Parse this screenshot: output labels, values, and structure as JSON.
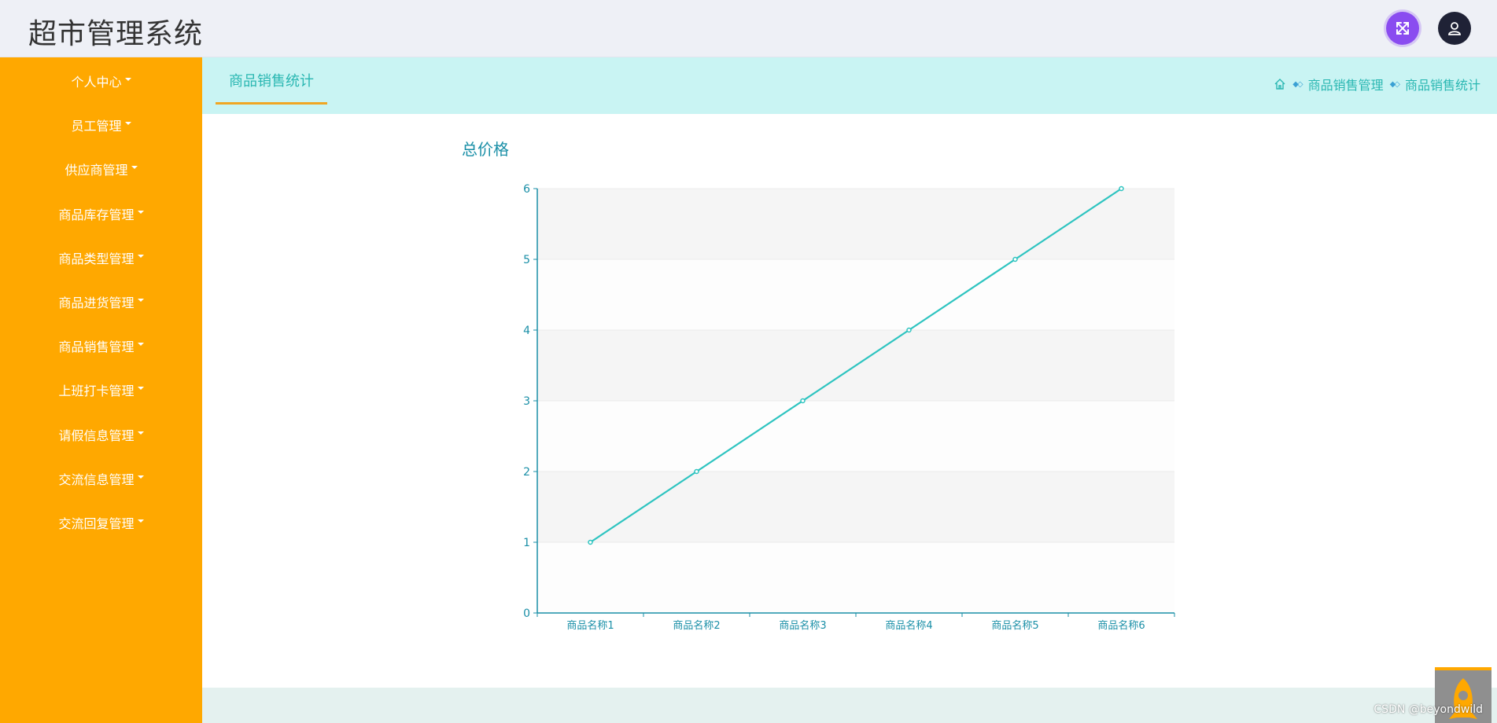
{
  "app": {
    "title": "超市管理系统"
  },
  "header": {
    "fullscreen_icon": "fullscreen-icon",
    "user_icon": "user-icon",
    "accent": "#8a4cf0"
  },
  "sidebar": {
    "background": "#ffa800",
    "items": [
      {
        "label": "个人中心"
      },
      {
        "label": "员工管理"
      },
      {
        "label": "供应商管理"
      },
      {
        "label": "商品库存管理"
      },
      {
        "label": "商品类型管理"
      },
      {
        "label": "商品进货管理"
      },
      {
        "label": "商品销售管理"
      },
      {
        "label": "上班打卡管理"
      },
      {
        "label": "请假信息管理"
      },
      {
        "label": "交流信息管理"
      },
      {
        "label": "交流回复管理"
      }
    ]
  },
  "tabs": [
    {
      "label": "商品销售统计",
      "active": true
    }
  ],
  "breadcrumb": {
    "home_icon": "home-icon",
    "items": [
      "商品销售管理",
      "商品销售统计"
    ]
  },
  "chart_data": {
    "type": "line",
    "title": "总价格",
    "categories": [
      "商品名称1",
      "商品名称2",
      "商品名称3",
      "商品名称4",
      "商品名称5",
      "商品名称6"
    ],
    "series": [
      {
        "values": [
          1,
          2,
          3,
          4,
          5,
          6
        ],
        "color": "#2ec4c0"
      }
    ],
    "yticks": [
      0,
      1,
      2,
      3,
      4,
      5,
      6
    ],
    "ylim": [
      0,
      6
    ],
    "grid": "alternating horizontal bands",
    "axis_color": "#1a8fa7"
  },
  "footer": {
    "watermark": "CSDN @beyondwild"
  }
}
